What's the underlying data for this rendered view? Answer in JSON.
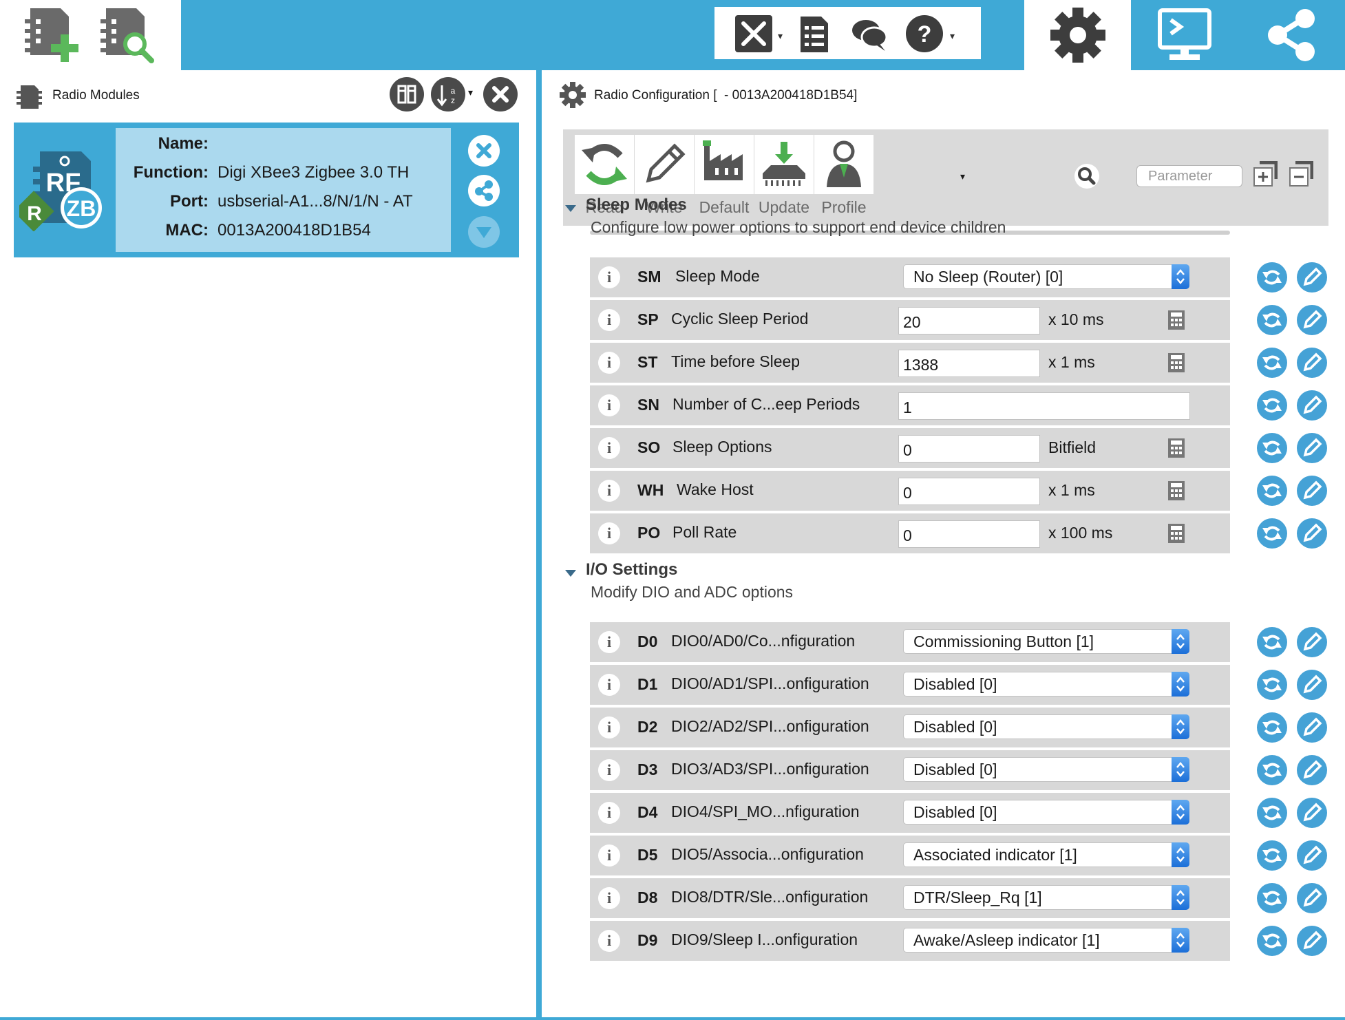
{
  "colors": {
    "accent": "#3fa9d6",
    "row_bg": "#d8d8d8",
    "card_info_bg": "#abd9ee",
    "select_arrow": "#2a7fe0",
    "toolbar_bg": "#dadada"
  },
  "topbar": {
    "left_icons": [
      "add-device-icon",
      "discover-devices-icon"
    ],
    "tools_icons": [
      "tools-icon",
      "xctu-log-icon",
      "feedback-icon",
      "help-icon"
    ],
    "modes": [
      "configuration-mode-icon",
      "consoles-mode-icon",
      "network-mode-icon"
    ]
  },
  "left_panel": {
    "title": "Radio Modules",
    "module": {
      "name_label": "Name:",
      "name_value": "",
      "function_label": "Function:",
      "function_value": "Digi XBee3 Zigbee 3.0 TH",
      "port_label": "Port:",
      "port_value": "usbserial-A1...8/N/1/N - AT",
      "mac_label": "MAC:",
      "mac_value": "0013A200418D1B54",
      "icon_text": "RF",
      "badge_r": "R",
      "badge_zb": "ZB"
    }
  },
  "right_panel": {
    "title": "Radio Configuration [  - 0013A200418D1B54]",
    "toolbar": {
      "read": "Read",
      "write": "Write",
      "default": "Default",
      "update": "Update",
      "profile": "Profile"
    },
    "search_placeholder": "Parameter",
    "sections": [
      {
        "title": "Sleep Modes",
        "description": "Configure low power options to support end device children",
        "params": [
          {
            "code": "SM",
            "name": "Sleep Mode",
            "type": "select",
            "value": "No Sleep (Router) [0]"
          },
          {
            "code": "SP",
            "name": "Cyclic Sleep Period",
            "type": "input",
            "value": "20",
            "unit": "x 10 ms"
          },
          {
            "code": "ST",
            "name": "Time before Sleep",
            "type": "input",
            "value": "1388",
            "unit": "x 1 ms"
          },
          {
            "code": "SN",
            "name": "Number of C...eep Periods",
            "type": "wide",
            "value": "1"
          },
          {
            "code": "SO",
            "name": "Sleep Options",
            "type": "input",
            "value": "0",
            "unit": "Bitfield"
          },
          {
            "code": "WH",
            "name": "Wake Host",
            "type": "input",
            "value": "0",
            "unit": "x 1 ms"
          },
          {
            "code": "PO",
            "name": "Poll Rate",
            "type": "input",
            "value": "0",
            "unit": "x 100 ms"
          }
        ]
      },
      {
        "title": "I/O Settings",
        "description": "Modify DIO and ADC options",
        "params": [
          {
            "code": "D0",
            "name": "DIO0/AD0/Co...nfiguration",
            "type": "select",
            "value": "Commissioning Button [1]"
          },
          {
            "code": "D1",
            "name": "DIO0/AD1/SPI...onfiguration",
            "type": "select",
            "value": "Disabled [0]"
          },
          {
            "code": "D2",
            "name": "DIO2/AD2/SPI...onfiguration",
            "type": "select",
            "value": "Disabled [0]"
          },
          {
            "code": "D3",
            "name": "DIO3/AD3/SPI...onfiguration",
            "type": "select",
            "value": "Disabled [0]"
          },
          {
            "code": "D4",
            "name": "DIO4/SPI_MO...nfiguration",
            "type": "select",
            "value": "Disabled [0]"
          },
          {
            "code": "D5",
            "name": "DIO5/Associa...onfiguration",
            "type": "select",
            "value": "Associated indicator [1]"
          },
          {
            "code": "D8",
            "name": "DIO8/DTR/Sle...onfiguration",
            "type": "select",
            "value": "DTR/Sleep_Rq [1]"
          },
          {
            "code": "D9",
            "name": "DIO9/Sleep I...onfiguration",
            "type": "select",
            "value": "Awake/Asleep indicator [1]"
          }
        ]
      }
    ]
  }
}
